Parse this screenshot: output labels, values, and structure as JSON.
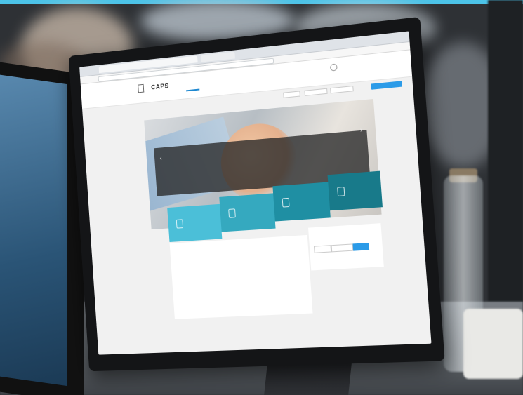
{
  "scene": {
    "description_tag": "photo-of-desk-with-monitor",
    "accent_color": "#4cc3e8"
  },
  "screen": {
    "logo": "CAPS",
    "nav_tab": "",
    "hero_title": "",
    "hero_subtitle": "",
    "tiles": [
      {
        "color": "#4bbfd8",
        "label": ""
      },
      {
        "color": "#35a9bf",
        "label": ""
      },
      {
        "color": "#1f8fa3",
        "label": ""
      },
      {
        "color": "#187a8a",
        "label": ""
      }
    ],
    "tabs": [
      "",
      "",
      "",
      ""
    ],
    "side_title": ""
  },
  "icons": {
    "arrow_left": "‹",
    "arrow_right": "›"
  }
}
